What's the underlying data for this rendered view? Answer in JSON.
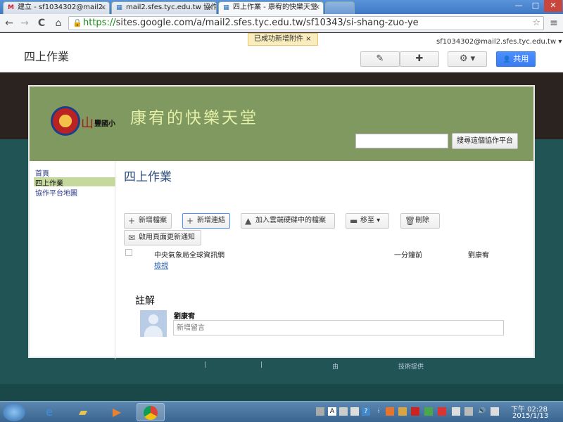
{
  "tabs": [
    {
      "icon": "M",
      "label": "建立 - sf1034302@mail2."
    },
    {
      "icon": "▦",
      "label": "mail2.sfes.tyc.edu.tw 協作"
    },
    {
      "icon": "▦",
      "label": "四上作業 - 康宥的快樂天堂"
    }
  ],
  "window": {
    "minimize": "—",
    "maximize": "□",
    "close": "✕"
  },
  "browser": {
    "url_scheme": "https://",
    "url_rest": "sites.google.com/a/mail2.sfes.tyc.edu.tw/sf10343/si-shang-zuo-ye",
    "back": "←",
    "forward": "→",
    "reload": "C",
    "home": "⌂",
    "star": "☆",
    "menu": "≡"
  },
  "sites_header": {
    "page_name": "四上作業",
    "notice": "已成功新增附件 ×",
    "user_email": "sf1034302@mail2.sfes.tyc.edu.tw ▾",
    "edit_icon": "✎",
    "newpage_icon": "✚",
    "gear_icon": "⚙ ▾",
    "share_label": "共用"
  },
  "site": {
    "logo_mark": "山",
    "logo_text": "豐國小",
    "title": "康宥的快樂天堂",
    "search_placeholder": "",
    "search_button": "搜尋這個協作平台",
    "nav": [
      "首頁",
      "四上作業",
      "協作平台地圖"
    ],
    "page_title": "四上作業",
    "toolbar": {
      "add_file": "新增檔案",
      "add_link": "新增連結",
      "add_drive": "加入雲端硬碟中的檔案",
      "move_to": "移至",
      "delete": "刪除",
      "enable_notify": "啟用頁面更新通知"
    },
    "files": [
      {
        "name": "中央氣象局全球資訊網",
        "action": "檢視",
        "time": "一分鐘前",
        "owner": "劉康宥"
      }
    ],
    "comments": {
      "title": "註解",
      "user": "劉康宥",
      "placeholder": "新增留言"
    },
    "footer": [
      "|",
      "|",
      "由",
      "技術提供"
    ]
  },
  "taskbar": {
    "clock_time": "下午 02:28",
    "clock_date": "2015/1/13"
  }
}
